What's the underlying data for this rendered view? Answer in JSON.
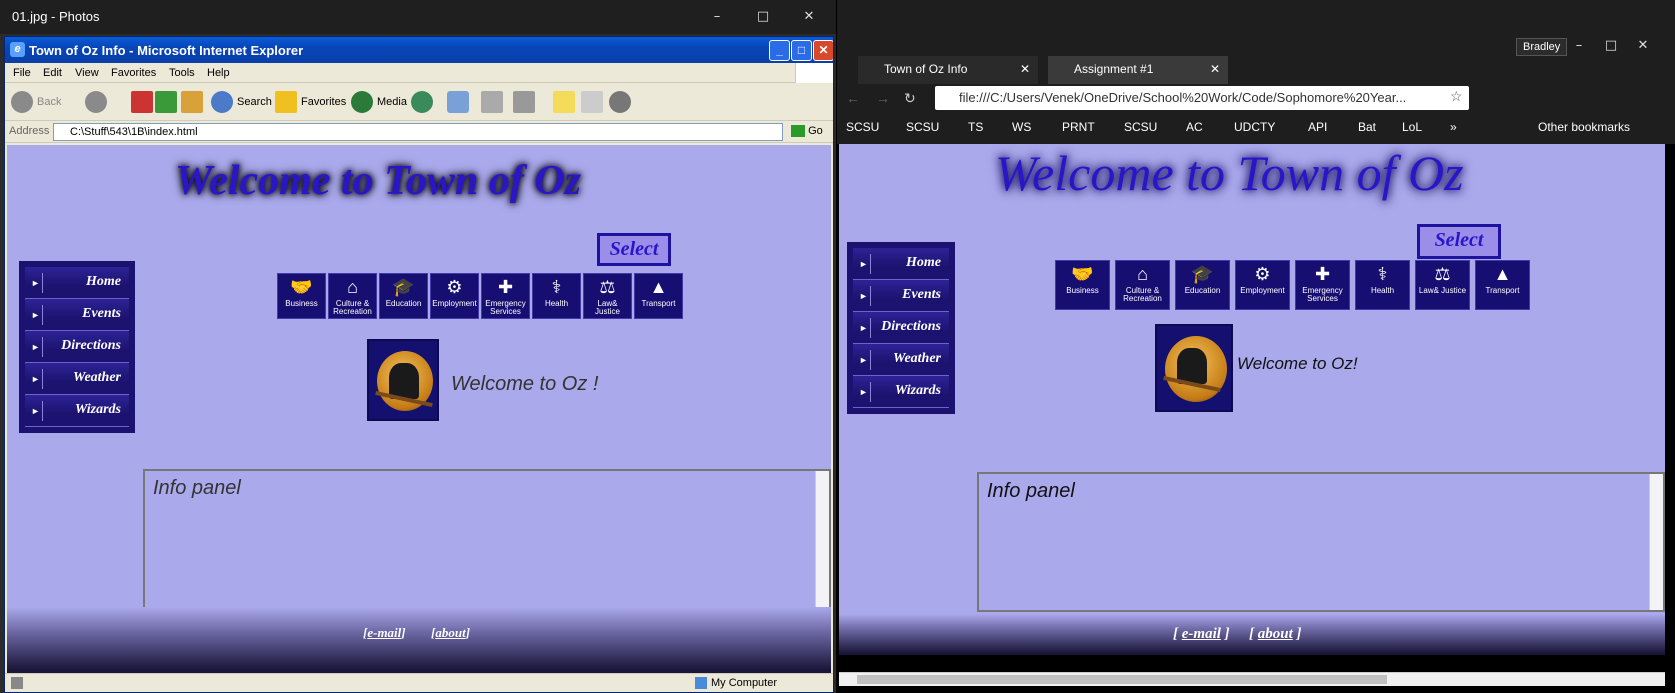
{
  "photos": {
    "title": "01.jpg - Photos",
    "min": "–",
    "max": "□",
    "close": "✕"
  },
  "ie": {
    "title": "Town of Oz Info - Microsoft Internet Explorer",
    "menu": [
      "File",
      "Edit",
      "View",
      "Favorites",
      "Tools",
      "Help"
    ],
    "toolbar": {
      "back": "Back",
      "search": "Search",
      "favorites": "Favorites",
      "media": "Media"
    },
    "address_label": "Address",
    "address_value": "C:\\Stuff\\543\\1B\\index.html",
    "go": "Go",
    "status": "My Computer"
  },
  "chrome": {
    "user": "Bradley",
    "tabs": [
      "Town of Oz Info",
      "Assignment #1"
    ],
    "url": "file:///C:/Users/Venek/OneDrive/School%20Work/Code/Sophomore%20Year...",
    "bookmarks": [
      "SCSU",
      "SCSU",
      "TS",
      "WS",
      "PRNT",
      "SCSU",
      "AC",
      "UDCTY",
      "API",
      "Bat",
      "LoL",
      "»",
      "Other bookmarks"
    ]
  },
  "page": {
    "welcome": "Welcome to Town of Oz",
    "select": "Select",
    "nav": [
      "Home",
      "Events",
      "Directions",
      "Weather",
      "Wizards"
    ],
    "icons": [
      {
        "label": "Business",
        "glyph": "🤝"
      },
      {
        "label": "Culture & Recreation",
        "glyph": "⌂"
      },
      {
        "label": "Education",
        "glyph": "🎓"
      },
      {
        "label": "Employment",
        "glyph": "⚙"
      },
      {
        "label": "Emergency Services",
        "glyph": "✚"
      },
      {
        "label": "Health",
        "glyph": "⚕"
      },
      {
        "label": "Law& Justice",
        "glyph": "⚖"
      },
      {
        "label": "Transport",
        "glyph": "▲"
      }
    ],
    "ie_welcome_oz": "Welcome to Oz !",
    "chrome_welcome_oz": "Welcome to Oz!",
    "info_panel": "Info panel",
    "footer_email": "e-mail",
    "footer_about": "about"
  }
}
